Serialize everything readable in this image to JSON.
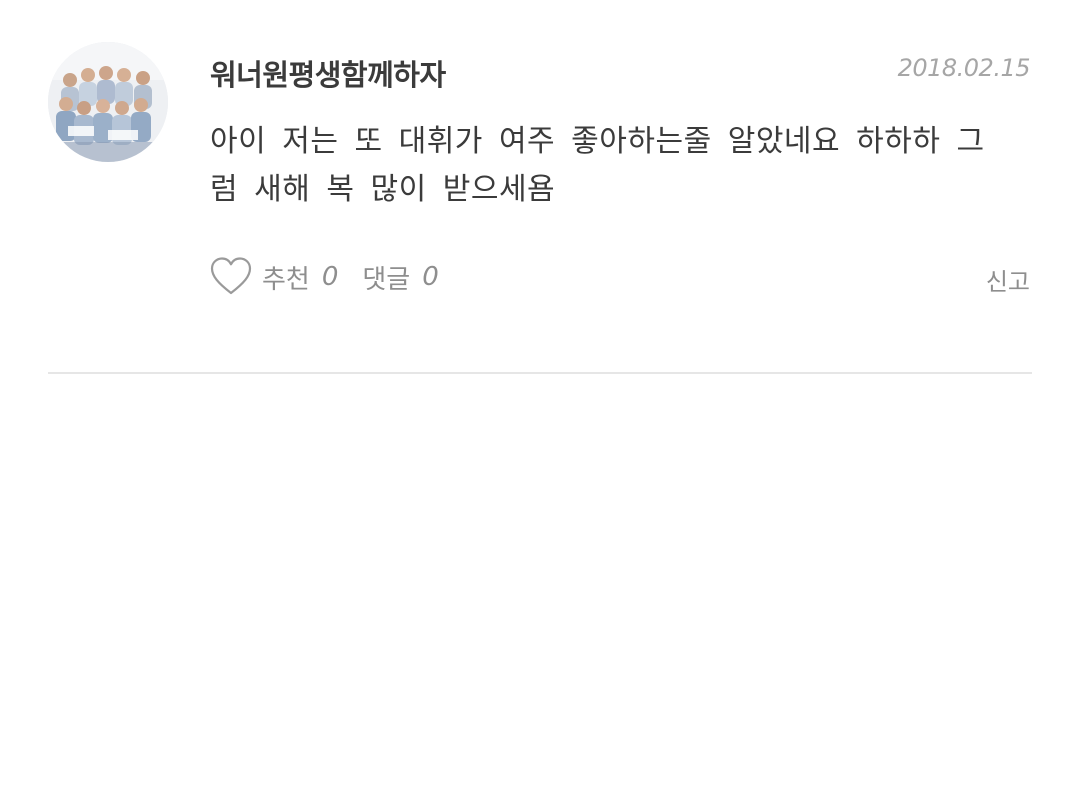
{
  "comment": {
    "username": "워너원평생함께하자",
    "date": "2018.02.15",
    "text": "아이 저는 또 대휘가 여주 좋아하는줄 알았네요 하하하 그럼 새해 복 많이 받으세욤",
    "actions": {
      "like_label": "추천",
      "like_count": "0",
      "reply_label": "댓글",
      "reply_count": "0",
      "report_label": "신고"
    },
    "icons": {
      "like": "heart-outline-icon",
      "avatar": "group-photo-avatar"
    }
  },
  "colors": {
    "text": "#3b3b3b",
    "muted": "#8e8e8e",
    "date": "#a6a6a6",
    "divider": "#e6e6e6"
  }
}
